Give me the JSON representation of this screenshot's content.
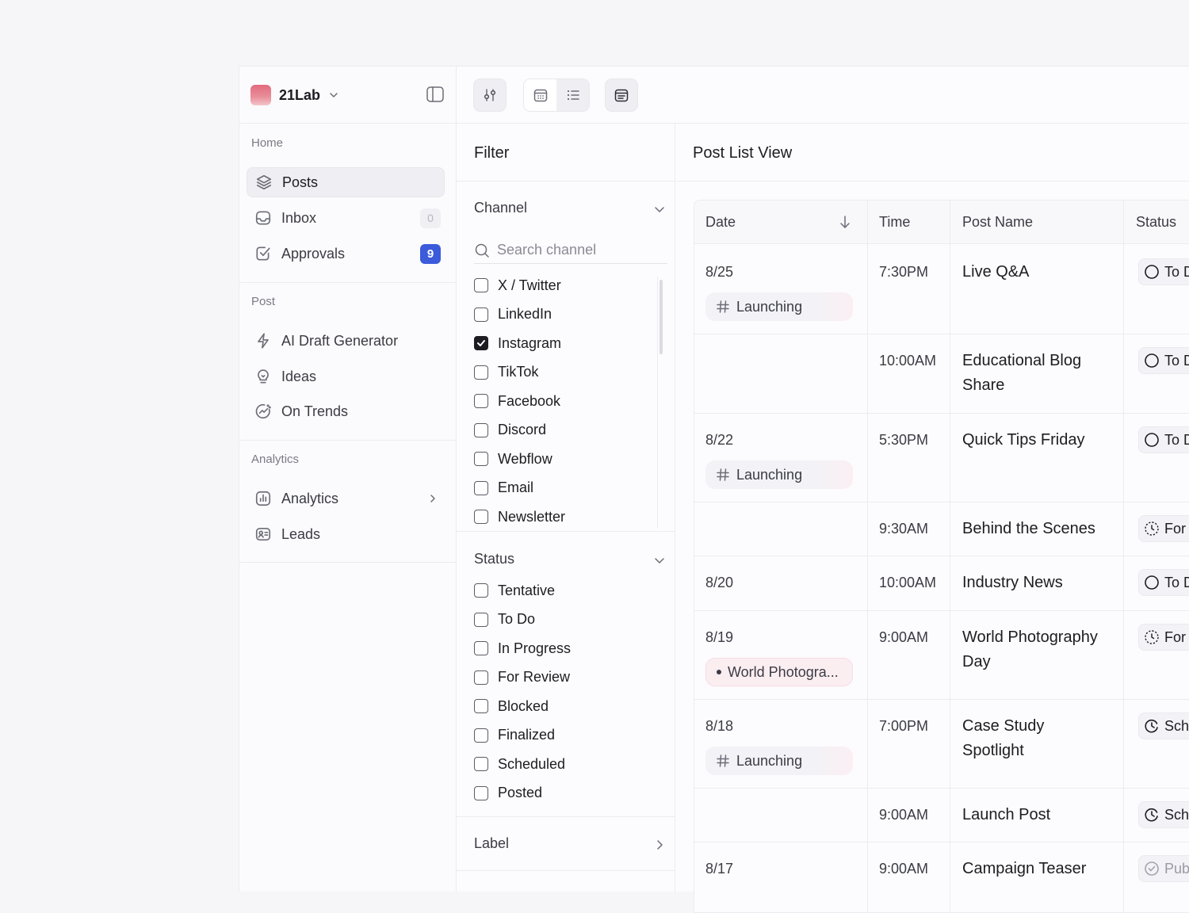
{
  "workspace": {
    "name": "21Lab"
  },
  "sidebar": {
    "sections": [
      {
        "title": "Home",
        "items": [
          {
            "label": "Posts",
            "icon": "layers-icon",
            "active": true
          },
          {
            "label": "Inbox",
            "icon": "inbox-icon",
            "badge": "0",
            "badge_style": "muted"
          },
          {
            "label": "Approvals",
            "icon": "checkbox-icon",
            "badge": "9",
            "badge_style": "blue"
          }
        ]
      },
      {
        "title": "Post",
        "items": [
          {
            "label": "AI Draft Generator",
            "icon": "bolt-icon"
          },
          {
            "label": "Ideas",
            "icon": "lightbulb-icon"
          },
          {
            "label": "On Trends",
            "icon": "trend-icon"
          }
        ]
      },
      {
        "title": "Analytics",
        "items": [
          {
            "label": "Analytics",
            "icon": "chart-icon",
            "chevron": true
          },
          {
            "label": "Leads",
            "icon": "contact-card-icon"
          }
        ]
      }
    ]
  },
  "filter": {
    "title": "Filter",
    "channel": {
      "title": "Channel",
      "search_placeholder": "Search channel",
      "options": [
        {
          "label": "X / Twitter",
          "checked": false
        },
        {
          "label": "LinkedIn",
          "checked": false
        },
        {
          "label": "Instagram",
          "checked": true
        },
        {
          "label": "TikTok",
          "checked": false
        },
        {
          "label": "Facebook",
          "checked": false
        },
        {
          "label": "Discord",
          "checked": false
        },
        {
          "label": "Webflow",
          "checked": false
        },
        {
          "label": "Email",
          "checked": false
        },
        {
          "label": "Newsletter",
          "checked": false
        }
      ]
    },
    "status": {
      "title": "Status",
      "options": [
        {
          "label": "Tentative",
          "checked": false
        },
        {
          "label": "To Do",
          "checked": false
        },
        {
          "label": "In Progress",
          "checked": false
        },
        {
          "label": "For Review",
          "checked": false
        },
        {
          "label": "Blocked",
          "checked": false
        },
        {
          "label": "Finalized",
          "checked": false
        },
        {
          "label": "Scheduled",
          "checked": false
        },
        {
          "label": "Posted",
          "checked": false
        }
      ]
    },
    "label": {
      "title": "Label"
    }
  },
  "main": {
    "title": "Post List View",
    "columns": {
      "date": "Date",
      "time": "Time",
      "post_name": "Post Name",
      "status": "Status"
    },
    "rows": [
      {
        "date": "8/25",
        "tag": "Launching",
        "tag_style": "launch",
        "time": "7:30PM",
        "name_lines": [
          "Live Q&A"
        ],
        "status": "To D",
        "status_icon": "circle"
      },
      {
        "date": "",
        "tag": "",
        "time": "10:00AM",
        "name_lines": [
          "Educational Blog",
          "Share"
        ],
        "status": "To D",
        "status_icon": "circle"
      },
      {
        "date": "8/22",
        "tag": "Launching",
        "tag_style": "launch",
        "time": "5:30PM",
        "name_lines": [
          "Quick Tips Friday"
        ],
        "status": "To D",
        "status_icon": "circle"
      },
      {
        "date": "",
        "tag": "",
        "time": "9:30AM",
        "name_lines": [
          "Behind the Scenes"
        ],
        "status": "For",
        "status_icon": "review"
      },
      {
        "date": "8/20",
        "tag": "",
        "time": "10:00AM",
        "name_lines": [
          "Industry News"
        ],
        "status": "To D",
        "status_icon": "circle"
      },
      {
        "date": "8/19",
        "tag": "World Photogra...",
        "tag_style": "world",
        "time": "9:00AM",
        "name_lines": [
          "World Photography",
          "Day"
        ],
        "status": "For",
        "status_icon": "review"
      },
      {
        "date": "8/18",
        "tag": "Launching",
        "tag_style": "launch",
        "time": "7:00PM",
        "name_lines": [
          "Case Study",
          "Spotlight"
        ],
        "status": "Sch",
        "status_icon": "scheduled"
      },
      {
        "date": "",
        "tag": "",
        "time": "9:00AM",
        "name_lines": [
          "Launch Post"
        ],
        "status": "Sch",
        "status_icon": "scheduled"
      },
      {
        "date": "8/17",
        "tag": "",
        "time": "9:00AM",
        "name_lines": [
          "Campaign Teaser"
        ],
        "status": "Pub",
        "status_icon": "published"
      }
    ]
  }
}
